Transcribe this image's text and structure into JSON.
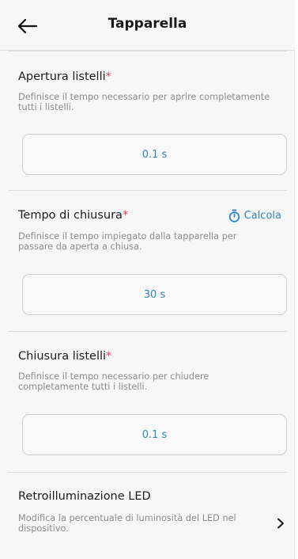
{
  "header": {
    "title": "Tapparella",
    "back_icon": "arrow-left-icon"
  },
  "sections": [
    {
      "title": "Apertura listelli",
      "required_mark": "*",
      "description": "Definisce il tempo necessario per aprire completamente tutti i listelli.",
      "value": "0.1 s"
    },
    {
      "title": "Tempo di chiusura",
      "required_mark": "*",
      "description": "Definisce il tempo impiegato dalla tapparella per passare da aperta a chiusa.",
      "value": "30 s",
      "action": {
        "label": "Calcola",
        "icon": "stopwatch-icon"
      }
    },
    {
      "title": "Chiusura listelli",
      "required_mark": "*",
      "description": "Definisce il tempo necessario per chiudere completamente tutti i listelli.",
      "value": "0.1 s"
    }
  ],
  "led": {
    "title": "Retroilluminazione LED",
    "description": "Modifica la percentuale di luminosità del LED nel dispositivo.",
    "icon": "chevron-right-icon"
  },
  "colors": {
    "accent": "#2f86c4",
    "required": "#d9475b",
    "muted_text": "#8c8c8c"
  }
}
